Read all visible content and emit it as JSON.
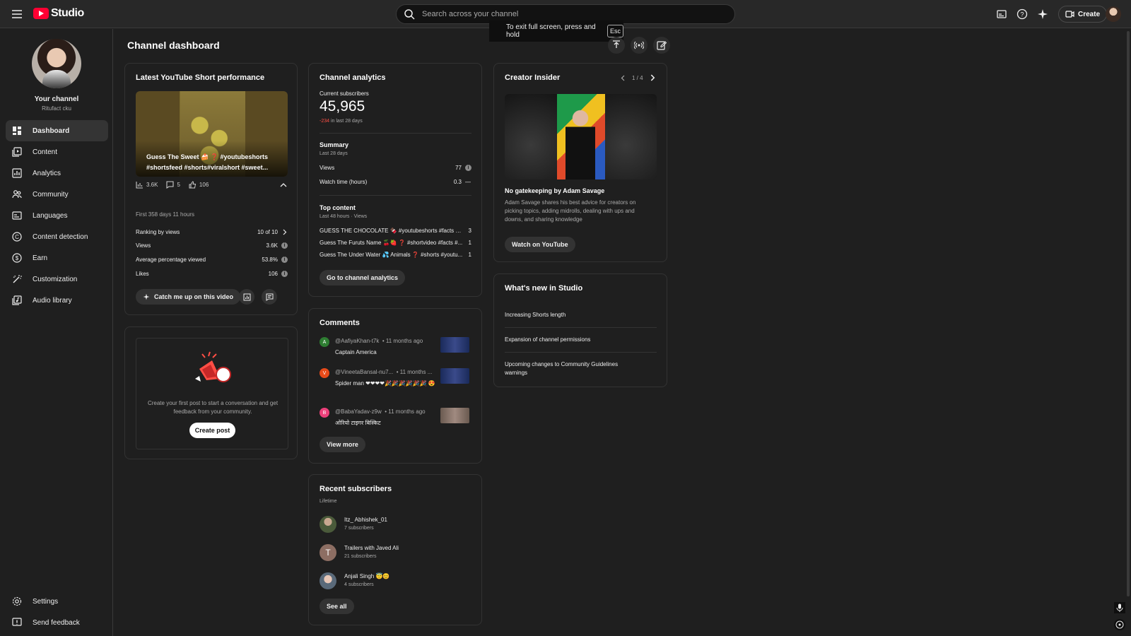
{
  "header": {
    "logo_text": "Studio",
    "search_placeholder": "Search across your channel",
    "create_label": "Create",
    "fullscreen_toast": "To exit full screen, press and hold",
    "fullscreen_key": "Esc"
  },
  "sidebar": {
    "channel_title": "Your channel",
    "channel_name": "Ritufact cku",
    "items": [
      {
        "label": "Dashboard",
        "icon": "dashboard-icon"
      },
      {
        "label": "Content",
        "icon": "content-icon"
      },
      {
        "label": "Analytics",
        "icon": "analytics-icon"
      },
      {
        "label": "Community",
        "icon": "community-icon"
      },
      {
        "label": "Languages",
        "icon": "languages-icon"
      },
      {
        "label": "Content detection",
        "icon": "content-detection-icon"
      },
      {
        "label": "Earn",
        "icon": "earn-icon"
      },
      {
        "label": "Customization",
        "icon": "customization-icon"
      },
      {
        "label": "Audio library",
        "icon": "audio-library-icon"
      }
    ],
    "settings_label": "Settings",
    "feedback_label": "Send feedback"
  },
  "page": {
    "title": "Channel dashboard"
  },
  "short_card": {
    "title": "Latest YouTube Short performance",
    "video_caption": "Guess The Sweet 🍰 ❓ #youtubeshorts #shortsfeed #shorts#viralshort #sweet...",
    "views_short": "3.6K",
    "comments_short": "5",
    "likes_short": "106",
    "period": "First 358 days 11 hours",
    "metrics": [
      {
        "label": "Ranking by views",
        "value": "10 of 10"
      },
      {
        "label": "Views",
        "value": "3.6K"
      },
      {
        "label": "Average percentage viewed",
        "value": "53.8%"
      },
      {
        "label": "Likes",
        "value": "106"
      }
    ],
    "catch_up_label": "Catch me up on this video"
  },
  "post_card": {
    "text": "Create your first post to start a conversation and get feedback from your community.",
    "button": "Create post"
  },
  "analytics": {
    "title": "Channel analytics",
    "current_subs_label": "Current subscribers",
    "current_subs": "45,965",
    "change": "-234",
    "change_suffix": "in last 28 days",
    "summary_title": "Summary",
    "summary_period": "Last 28 days",
    "summary_rows": [
      {
        "label": "Views",
        "value": "77"
      },
      {
        "label": "Watch time (hours)",
        "value": "0.3"
      }
    ],
    "top_title": "Top content",
    "top_period": "Last 48 hours · Views",
    "top_rows": [
      {
        "title": "GUESS THE CHOCOLATE 🍫 #youtubeshorts #facts #s...",
        "value": "3"
      },
      {
        "title": "Guess The Furuts Name 🍒🍓 ❓ #shortvideo #facts #...",
        "value": "1"
      },
      {
        "title": "Guess The Under Water 💦 Animals ❓ #shorts #youtu...",
        "value": "1"
      }
    ],
    "button": "Go to channel analytics"
  },
  "comments": {
    "title": "Comments",
    "items": [
      {
        "initial": "A",
        "author": "@AafiyaKhan-t7k",
        "time": "• 11 months ago",
        "text": "Captain America",
        "color": "#2e7d32"
      },
      {
        "initial": "V",
        "author": "@VineetaBansal-nu7...",
        "time": "• 11 months ...",
        "text": "Spider man ❤❤❤❤🎉🎉🎉🎉🎉🎉 😍",
        "color": "#e64a19"
      },
      {
        "initial": "B",
        "author": "@BabaYadav-z9w",
        "time": "• 11 months ago",
        "text": "ओरियो टाइगर बिस्किट",
        "color": "#ec407a"
      }
    ],
    "button": "View more"
  },
  "subscribers": {
    "title": "Recent subscribers",
    "period": "Lifetime",
    "items": [
      {
        "name": "Itz_ Abhishek_01",
        "count": "7 subscribers"
      },
      {
        "name": "Trailers with Javed Ali",
        "count": "21 subscribers",
        "initial": "T"
      },
      {
        "name": "Anjali Singh 😇😊",
        "count": "4 subscribers"
      }
    ],
    "button": "See all"
  },
  "creator_insider": {
    "title": "Creator Insider",
    "pager": "1 / 4",
    "headline": "No gatekeeping by Adam Savage",
    "description": "Adam Savage shares his best advice for creators on picking topics, adding midrolls, dealing with ups and downs, and sharing knowledge",
    "button": "Watch on YouTube"
  },
  "whats_new": {
    "title": "What's new in Studio",
    "items": [
      "Increasing Shorts length",
      "Expansion of channel permissions",
      "Upcoming changes to Community Guidelines warnings"
    ]
  },
  "colors": {
    "brand": "#ff0033",
    "background": "#1f1f1f",
    "negative": "#ff4e45"
  }
}
